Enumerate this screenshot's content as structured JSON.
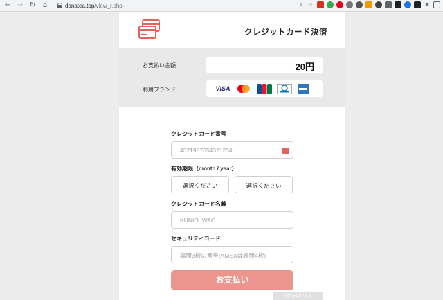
{
  "browser": {
    "url_host": "donatea.top",
    "url_path": "/view_r.php"
  },
  "header": {
    "title": "クレジットカード決済"
  },
  "summary": {
    "amount_label": "お支払い金額",
    "amount": "20円",
    "brand_label": "利用ブランド",
    "brands": [
      "VISA",
      "mastercard-icon",
      "jcb-icon",
      "diners-icon",
      "amex-icon"
    ]
  },
  "form": {
    "card_number_label": "クレジットカード番号",
    "card_number_placeholder": "4321987654321234",
    "expiry_label": "有効期限（month / year）",
    "month_select": "選択ください",
    "year_select": "選択ください",
    "name_label": "クレジットカード名義",
    "name_placeholder": "KUNIO IWAO",
    "cvc_label": "セキュリティコード",
    "cvc_placeholder": "裏面3桁の番号(AMEXは表面4桁)",
    "pay_button": "お支払い",
    "secondary_button": "決済を中止する"
  },
  "colors": {
    "accent": "#ec958e",
    "logo": "#e0645c",
    "summary_bg": "#e9e9e9"
  }
}
